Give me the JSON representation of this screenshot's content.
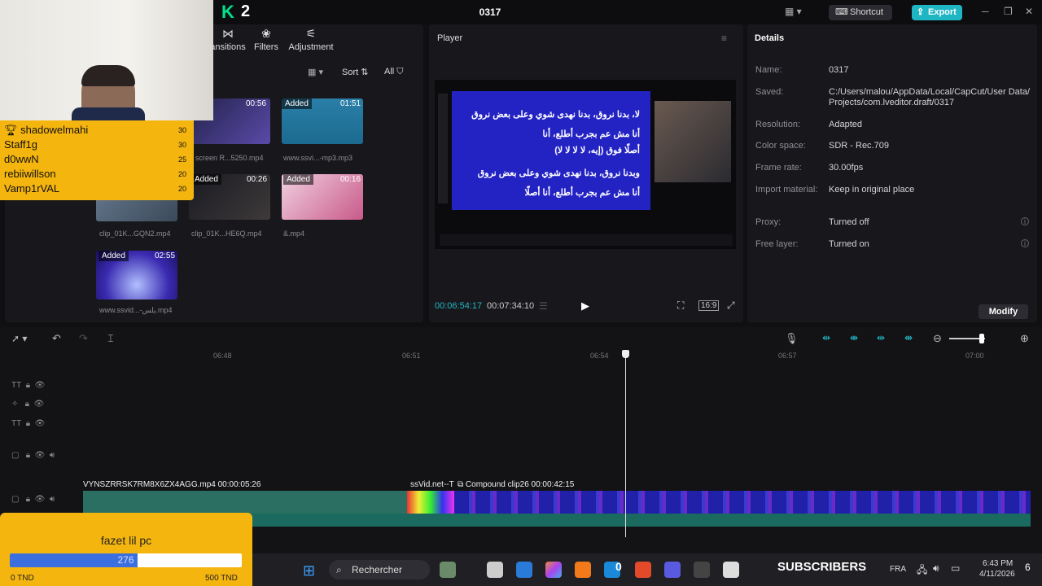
{
  "app": {
    "logo": "K",
    "logo_num": "2",
    "project_title": "0317",
    "shortcut_label": "Shortcut",
    "export_label": "Export"
  },
  "toolbar": {
    "transitions": "ansitions",
    "filters": "Filters",
    "adjustment": "Adjustment",
    "sort": "Sort",
    "all": "All"
  },
  "media": [
    {
      "badge": "",
      "dur": "00:56",
      "name": "screen R...5250.mp4"
    },
    {
      "badge": "Added",
      "dur": "01:51",
      "name": "www.ssvi...-mp3.mp3"
    },
    {
      "badge": "",
      "dur": "",
      "name": "clip_01K...GQN2.mp4"
    },
    {
      "badge": "Added",
      "dur": "00:26",
      "name": "clip_01K...HE6Q.mp4"
    },
    {
      "badge": "Added",
      "dur": "00:16",
      "name": "&.mp4"
    },
    {
      "badge": "Added",
      "dur": "02:55",
      "name": "www.ssvid...-يلس.mp4"
    }
  ],
  "leaderboard": [
    {
      "name": "shadowelmahi",
      "score": "30"
    },
    {
      "name": "Staff1g",
      "score": "30"
    },
    {
      "name": "d0wwN",
      "score": "25"
    },
    {
      "name": "rebiiwillson",
      "score": "20"
    },
    {
      "name": "Vamp1rVAL",
      "score": "20"
    }
  ],
  "player": {
    "title": "Player",
    "current_time": "00:06:54:17",
    "total_time": "00:07:34:10",
    "ratio": "16:9",
    "lyrics": [
      "لا، بدنا نروق، بدنا نهدى شوي وعلى بعض نروق",
      "أنا مش عم بجرب أطلع، أنا",
      "أصلًا فوق (إيه، لا لا لا لا)",
      "وبدنا نروق، بدنا نهدى شوي وعلى بعض نروق",
      "أنا مش عم بجرب أطلع، أنا أصلًا"
    ]
  },
  "details": {
    "title": "Details",
    "rows": [
      {
        "label": "Name:",
        "value": "0317"
      },
      {
        "label": "Saved:",
        "value": "C:/Users/malou/AppData/Local/CapCut/User Data/ Projects/com.lveditor.draft/0317"
      },
      {
        "label": "Resolution:",
        "value": "Adapted"
      },
      {
        "label": "Color space:",
        "value": "SDR - Rec.709"
      },
      {
        "label": "Frame rate:",
        "value": "30.00fps"
      },
      {
        "label": "Import material:",
        "value": "Keep in original place"
      },
      {
        "label": "Proxy:",
        "value": "Turned off"
      },
      {
        "label": "Free layer:",
        "value": "Turned on"
      }
    ],
    "modify_label": "Modify"
  },
  "timeline": {
    "ticks": [
      "06:48",
      "06:51",
      "06:54",
      "06:57",
      "07:00"
    ],
    "clip1": "VYNSZRRSK7RM8X6ZX4AGG.mp4   00:00:05:26",
    "clip2": "ssVid.net--T",
    "clip3": "Compound clip26   00:00:42:15"
  },
  "goal": {
    "title": "fazet lil pc",
    "current": "276",
    "fraction": 0.552,
    "min_label": "0 TND",
    "max_label": "500 TND"
  },
  "taskbar": {
    "search": "Rechercher",
    "subscribers": "SUBSCRIBERS",
    "subs_count": "0",
    "lang": "FRA",
    "time": "6:43 PM",
    "date": "4/11/2026",
    "notif": "6"
  }
}
